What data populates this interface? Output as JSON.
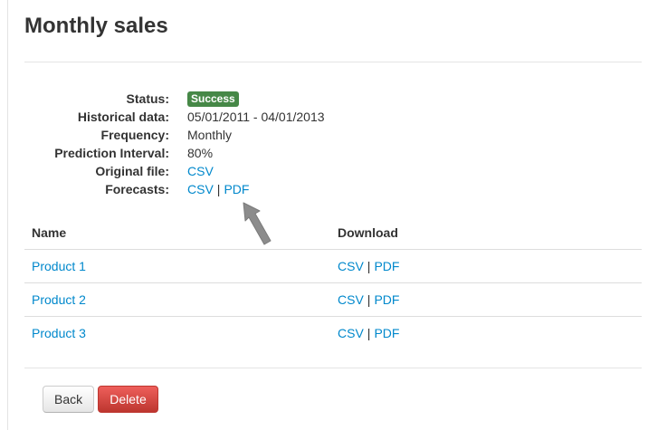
{
  "page": {
    "title": "Monthly sales"
  },
  "details": {
    "status": {
      "label": "Status:",
      "value": "Success",
      "color": "#468847"
    },
    "historical": {
      "label": "Historical data:",
      "value": "05/01/2011 - 04/01/2013"
    },
    "frequency": {
      "label": "Frequency:",
      "value": "Monthly"
    },
    "prediction_interval": {
      "label": "Prediction Interval:",
      "value": "80%"
    },
    "original_file": {
      "label": "Original file:",
      "link": "CSV"
    },
    "forecasts": {
      "label": "Forecasts:",
      "csv": "CSV",
      "separator": "|",
      "pdf": "PDF"
    }
  },
  "annotation": {
    "icon": "arrow-pointer-icon",
    "color": "#8c8c8c"
  },
  "table": {
    "headers": {
      "name": "Name",
      "download": "Download"
    },
    "rows": [
      {
        "name": "Product 1",
        "csv": "CSV",
        "separator": "|",
        "pdf": "PDF"
      },
      {
        "name": "Product 2",
        "csv": "CSV",
        "separator": "|",
        "pdf": "PDF"
      },
      {
        "name": "Product 3",
        "csv": "CSV",
        "separator": "|",
        "pdf": "PDF"
      }
    ]
  },
  "actions": {
    "back_label": "Back",
    "delete_label": "Delete"
  },
  "colors": {
    "link": "#0088cc",
    "danger": "#da4f49",
    "text": "#333333"
  }
}
